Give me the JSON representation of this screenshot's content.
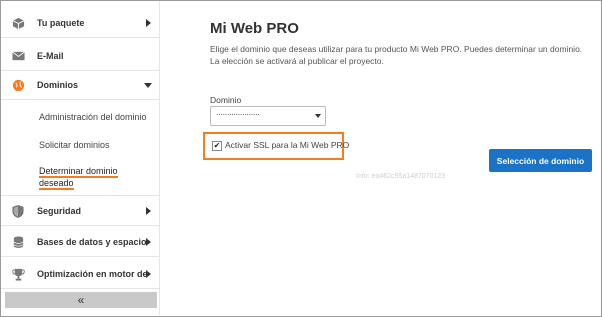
{
  "sidebar": {
    "items": [
      {
        "label": "Tu paquete",
        "icon": "package-icon"
      },
      {
        "label": "E-Mail",
        "icon": "envelope-icon"
      },
      {
        "label": "Dominios",
        "icon": "globe-icon"
      },
      {
        "label": "Seguridad",
        "icon": "shield-icon"
      },
      {
        "label": "Bases de datos y espacio ...",
        "icon": "database-icon"
      },
      {
        "label": "Optimización en motor de...",
        "icon": "trophy-icon"
      }
    ],
    "subitems": [
      {
        "label": "Administración del dominio"
      },
      {
        "label": "Solicitar dominios"
      },
      {
        "label": "Determinar dominio deseado"
      }
    ],
    "collapse": "«"
  },
  "main": {
    "title": "Mi Web PRO",
    "description": "Elige el dominio que deseas utilizar para tu producto Mi Web PRO. Puedes determinar un dominio. La elección se activará al publicar el proyecto.",
    "domain_label": "Dominio",
    "domain_value": "····················",
    "ssl_checked": "✔",
    "ssl_label": "Activar SSL para la Mi Web PRO",
    "info": "Info: ea462c95a1487070123",
    "button_label": "Selección de dominio"
  },
  "colors": {
    "accent": "#f47d20",
    "button": "#1a73c6",
    "dominios_icon": "#f47d20"
  }
}
